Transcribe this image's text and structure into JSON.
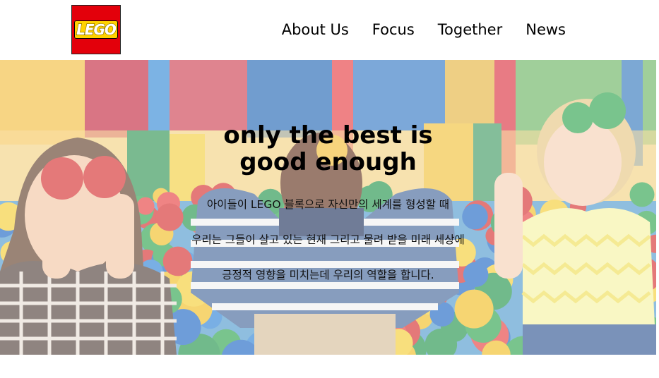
{
  "header": {
    "logo_text": "LEGO",
    "nav": [
      {
        "label": "About Us"
      },
      {
        "label": "Focus"
      },
      {
        "label": "Together"
      },
      {
        "label": "News"
      }
    ]
  },
  "hero": {
    "title_line1": "only the best is",
    "title_line2": "good enough",
    "lines": [
      "아이들이 LEGO 블록으로 자신만의 세계를 형성할 때",
      "우리는 그들이 살고 있는 현재 그리고 물려 받을 미래 세상에",
      "긍정적 영향을 미치는데 우리의 역할을 합니다."
    ]
  },
  "colors": {
    "brand_red": "#e3000b",
    "brand_yellow": "#ffd200"
  }
}
